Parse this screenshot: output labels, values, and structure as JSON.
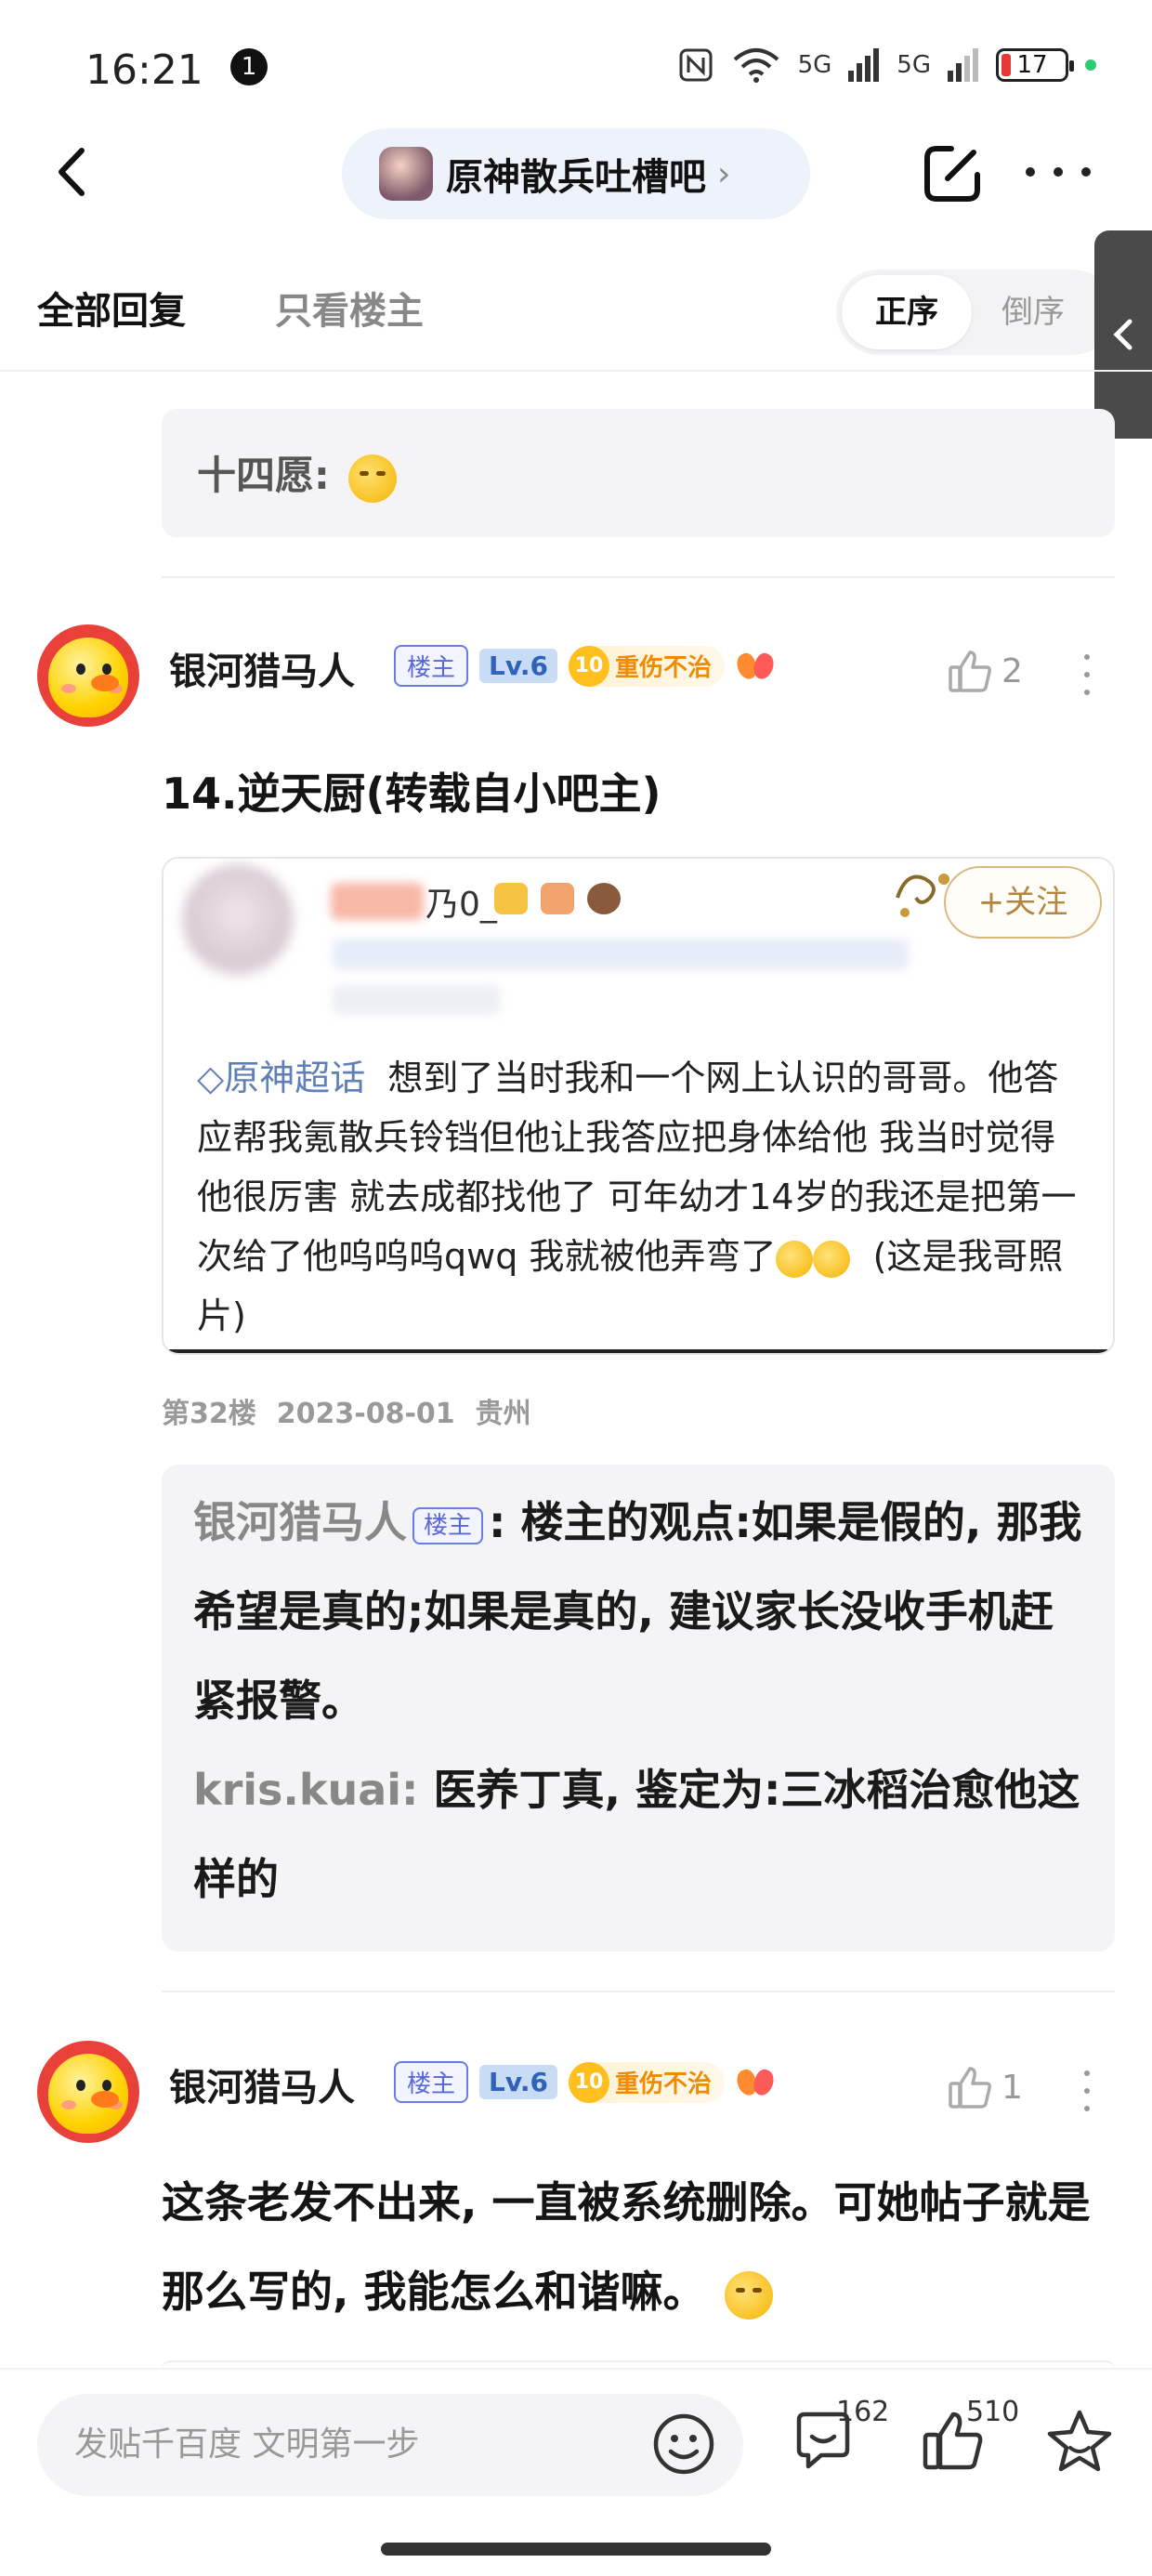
{
  "status_bar": {
    "time": "16:21",
    "notification_count": "1",
    "signal_labels": [
      "5G",
      "5G"
    ],
    "battery": "17"
  },
  "header": {
    "forum_name": "原神散兵吐槽吧",
    "chevron": "›"
  },
  "tabs": {
    "all_replies": "全部回复",
    "op_only": "只看楼主",
    "sort_asc": "正序",
    "sort_desc": "倒序"
  },
  "wish_box": {
    "text": "十四愿:"
  },
  "posts": [
    {
      "author": "银河猎马人",
      "op_badge": "楼主",
      "level": "Lv.6",
      "title_num": "10",
      "title_text": "重伤不治",
      "likes": "2",
      "title": "14.逆天厨(转载自小吧主)",
      "floor": "第32楼",
      "date": "2023-08-01",
      "location": "贵州",
      "screenshot": {
        "name_tail": "乃0_",
        "follow": "+关注",
        "topic": "原神超话",
        "body": "想到了当时我和一个网上认识的哥哥。他答应帮我氪散兵铃铛但他让我答应把身体给他 我当时觉得他很厉害 就去成都找他了 可年幼才14岁的我还是把第一次给了他呜呜呜qwq 我就被他弄弯了",
        "tail": "(这是我哥照片)"
      },
      "replies": [
        {
          "who": "银河猎马人",
          "badge": "楼主",
          "text": "楼主的观点:如果是假的, 那我希望是真的;如果是真的, 建议家长没收手机赶紧报警。"
        },
        {
          "who": "kris.kuai:",
          "text": "医养丁真, 鉴定为:三冰稻治愈他这样的"
        }
      ]
    },
    {
      "author": "银河猎马人",
      "op_badge": "楼主",
      "level": "Lv.6",
      "title_num": "10",
      "title_text": "重伤不治",
      "likes": "1",
      "body": "这条老发不出来, 一直被系统删除。可她帖子就是那么写的, 我能怎么和谐嘛。"
    }
  ],
  "bottom_bar": {
    "input_placeholder": "发贴千百度 文明第一步",
    "comment_count": "162",
    "like_count": "510"
  },
  "colors": {
    "accent_blue": "#5a67d8",
    "level_blue": "#2f62b8",
    "title_orange": "#f08a00",
    "battery_red": "#e53935"
  },
  "icons": [
    "back-arrow-icon",
    "chevron-right-icon",
    "edit-icon",
    "more-icon",
    "collapse-chevron-icon",
    "thumb-up-icon",
    "emoji-face-icon",
    "comment-icon",
    "star-icon"
  ]
}
